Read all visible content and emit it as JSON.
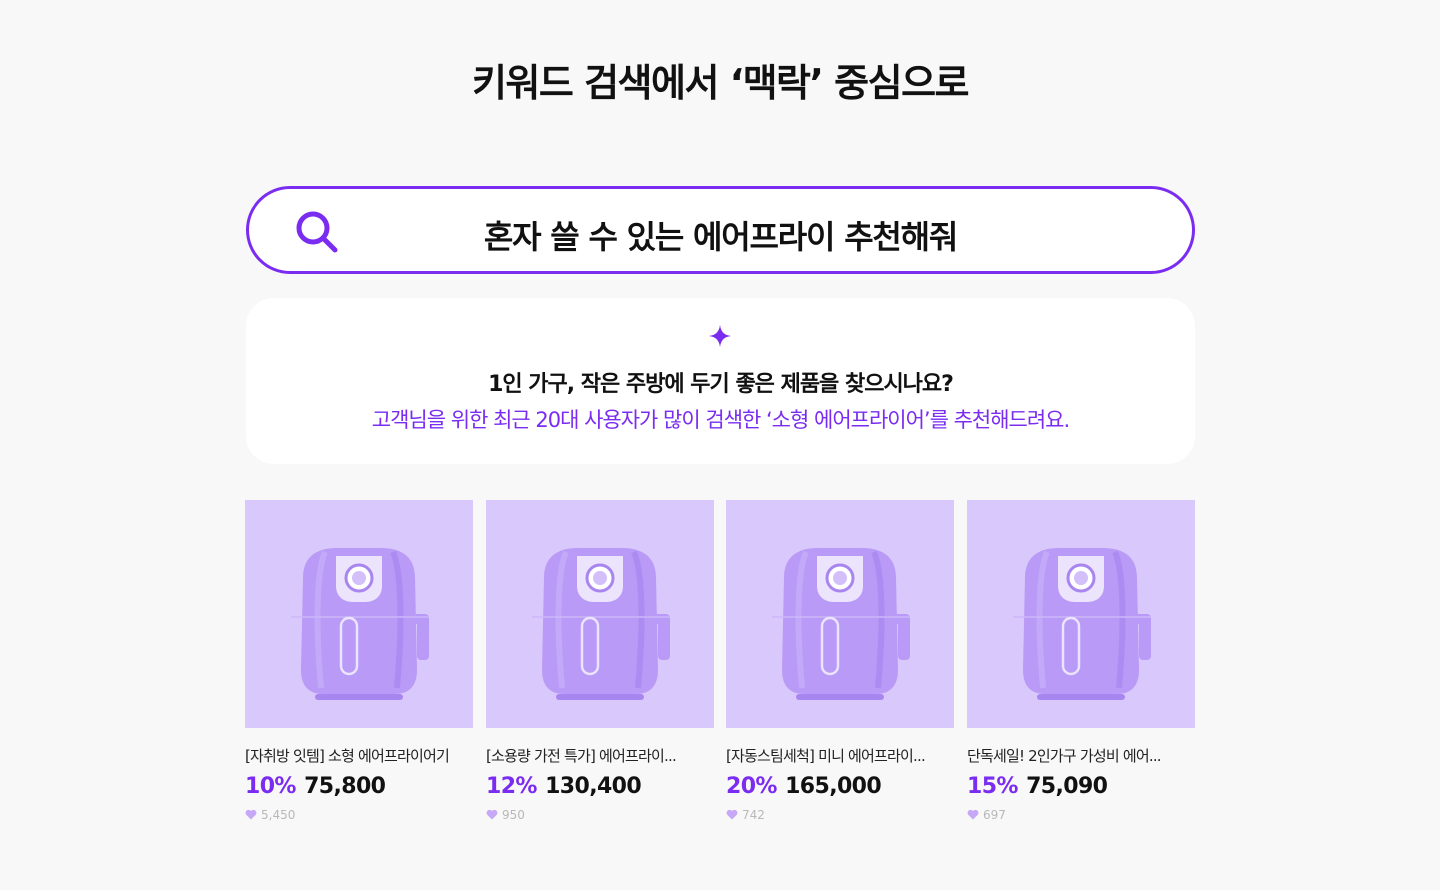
{
  "header": {
    "title": "키워드 검색에서 ‘맥락’ 중심으로"
  },
  "search": {
    "query": "혼자 쓸 수 있는 에어프라이 추천해줘",
    "icon": "search-icon"
  },
  "ai_card": {
    "icon": "sparkle-icon",
    "question": "1인 가구, 작은 주방에 두기 좋은 제품을 찾으시나요?",
    "answer": "고객님을 위한 최근 20대 사용자가 많이 검색한 ‘소형 에어프라이어’를 추천해드려요."
  },
  "colors": {
    "accent": "#7a2cf0",
    "thumb_bg": "#d9c8fb",
    "appliance": "#b99af6"
  },
  "products": [
    {
      "name": "[자취방 잇템] 소형 에어프라이어기",
      "discount": "10%",
      "price": "75,800",
      "likes": "5,450"
    },
    {
      "name": "[소용량 가전 특가] 에어프라이...",
      "discount": "12%",
      "price": "130,400",
      "likes": "950"
    },
    {
      "name": "[자동스팀세척] 미니 에어프라이...",
      "discount": "20%",
      "price": "165,000",
      "likes": "742"
    },
    {
      "name": "단독세일! 2인가구 가성비 에어...",
      "discount": "15%",
      "price": "75,090",
      "likes": "697"
    }
  ]
}
